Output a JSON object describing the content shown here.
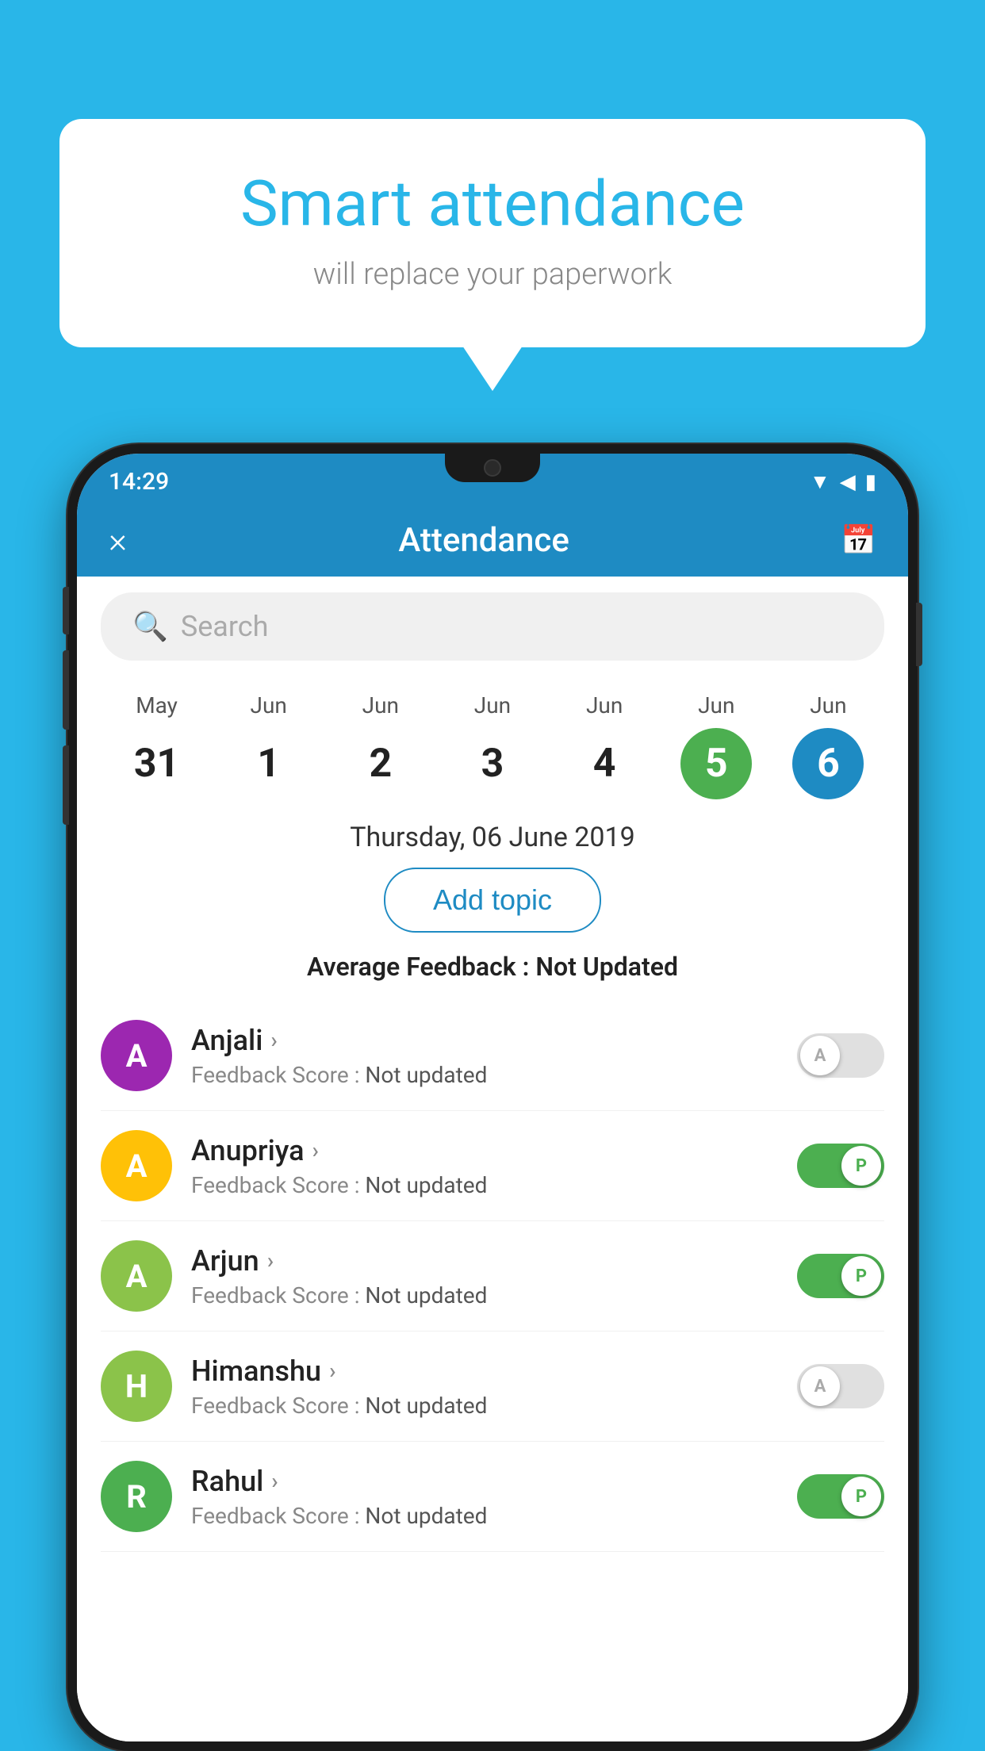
{
  "background_color": "#29b6e8",
  "bubble": {
    "title": "Smart attendance",
    "subtitle": "will replace your paperwork"
  },
  "status_bar": {
    "time": "14:29",
    "icons": [
      "wifi",
      "signal",
      "battery"
    ]
  },
  "app_bar": {
    "title": "Attendance",
    "close_label": "×",
    "calendar_icon": "📅"
  },
  "search": {
    "placeholder": "Search"
  },
  "calendar": {
    "days": [
      {
        "month": "May",
        "date": "31",
        "state": "normal"
      },
      {
        "month": "Jun",
        "date": "1",
        "state": "normal"
      },
      {
        "month": "Jun",
        "date": "2",
        "state": "normal"
      },
      {
        "month": "Jun",
        "date": "3",
        "state": "normal"
      },
      {
        "month": "Jun",
        "date": "4",
        "state": "normal"
      },
      {
        "month": "Jun",
        "date": "5",
        "state": "today"
      },
      {
        "month": "Jun",
        "date": "6",
        "state": "selected"
      }
    ]
  },
  "selected_date": "Thursday, 06 June 2019",
  "add_topic_label": "Add topic",
  "avg_feedback_label": "Average Feedback : ",
  "avg_feedback_value": "Not Updated",
  "students": [
    {
      "name": "Anjali",
      "initial": "A",
      "avatar_color": "#9c27b0",
      "feedback_label": "Feedback Score : ",
      "feedback_value": "Not updated",
      "toggle_state": "off",
      "toggle_label": "A"
    },
    {
      "name": "Anupriya",
      "initial": "A",
      "avatar_color": "#ffc107",
      "feedback_label": "Feedback Score : ",
      "feedback_value": "Not updated",
      "toggle_state": "on",
      "toggle_label": "P"
    },
    {
      "name": "Arjun",
      "initial": "A",
      "avatar_color": "#8bc34a",
      "feedback_label": "Feedback Score : ",
      "feedback_value": "Not updated",
      "toggle_state": "on",
      "toggle_label": "P"
    },
    {
      "name": "Himanshu",
      "initial": "H",
      "avatar_color": "#8bc34a",
      "feedback_label": "Feedback Score : ",
      "feedback_value": "Not updated",
      "toggle_state": "off",
      "toggle_label": "A"
    },
    {
      "name": "Rahul",
      "initial": "R",
      "avatar_color": "#4caf50",
      "feedback_label": "Feedback Score : ",
      "feedback_value": "Not updated",
      "toggle_state": "on",
      "toggle_label": "P"
    }
  ]
}
